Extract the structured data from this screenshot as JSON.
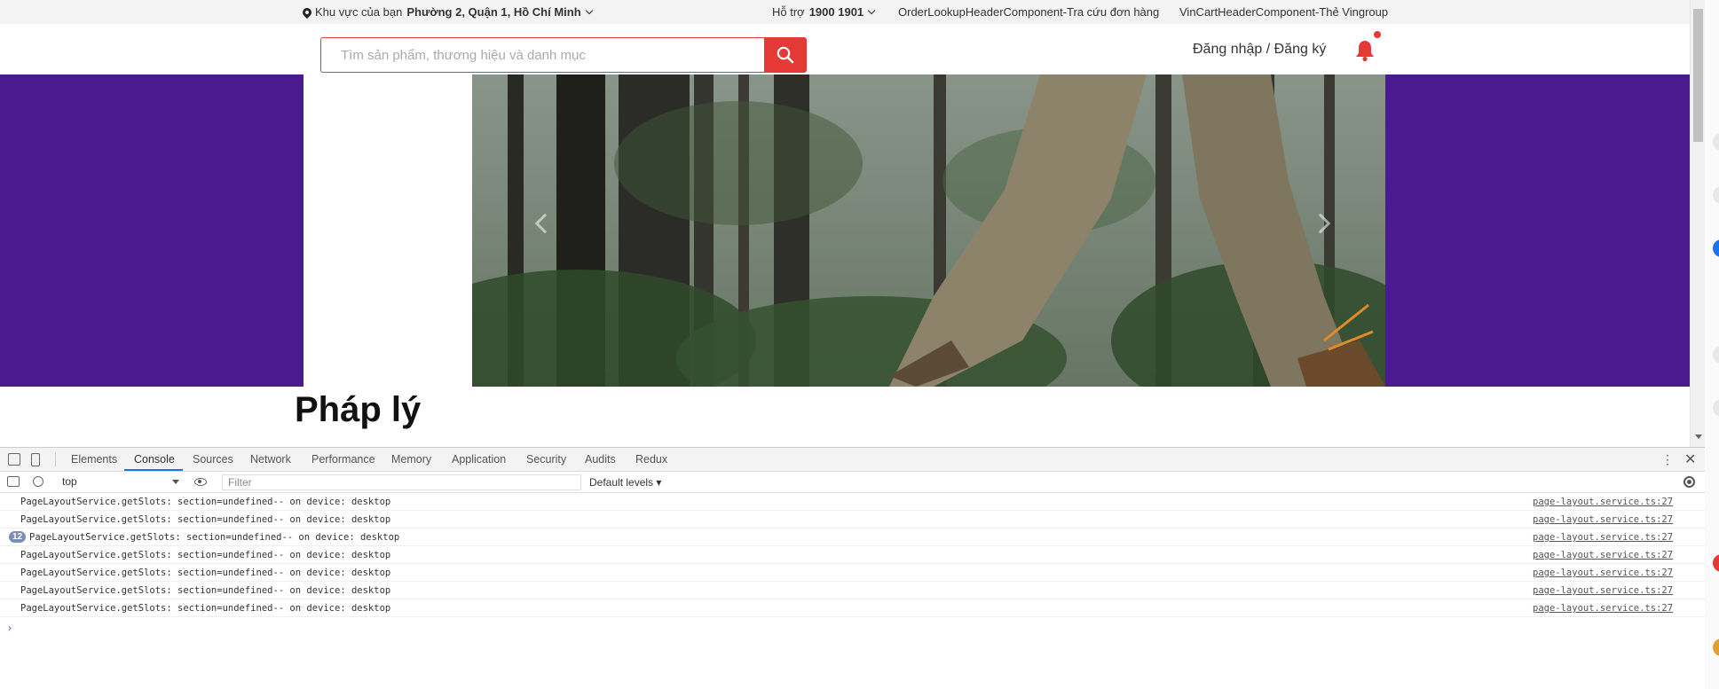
{
  "topbar": {
    "region_label": "Khu vực của bạn",
    "region_value": "Phường 2, Quận 1, Hồ Chí Minh",
    "support_label": "Hỗ trợ",
    "support_number": "1900 1901",
    "order_lookup": "OrderLookupHeaderComponent-Tra cứu đơn hàng",
    "vincart": "VinCartHeaderComponent-Thẻ Vingroup"
  },
  "header": {
    "search_placeholder": "Tìm sản phẩm, thương hiệu và danh mục",
    "login_register": "Đăng nhập / Đăng ký"
  },
  "page": {
    "title": "Pháp lý"
  },
  "colors": {
    "brand_red": "#e53935",
    "banner_purple": "#4a1a91"
  },
  "devtools": {
    "tabs": [
      "Elements",
      "Console",
      "Sources",
      "Network",
      "Performance",
      "Memory",
      "Application",
      "Security",
      "Audits",
      "Redux"
    ],
    "active_tab": "Console",
    "context": "top",
    "filter_placeholder": "Filter",
    "levels": "Default levels",
    "logs": [
      {
        "message": "PageLayoutService.getSlots: section=undefined-- on device: desktop",
        "source": "page-layout.service.ts:27",
        "count": null
      },
      {
        "message": "PageLayoutService.getSlots: section=undefined-- on device: desktop",
        "source": "page-layout.service.ts:27",
        "count": null
      },
      {
        "message": "PageLayoutService.getSlots: section=undefined-- on device: desktop",
        "source": "page-layout.service.ts:27",
        "count": "12"
      },
      {
        "message": "PageLayoutService.getSlots: section=undefined-- on device: desktop",
        "source": "page-layout.service.ts:27",
        "count": null
      },
      {
        "message": "PageLayoutService.getSlots: section=undefined-- on device: desktop",
        "source": "page-layout.service.ts:27",
        "count": null
      },
      {
        "message": "PageLayoutService.getSlots: section=undefined-- on device: desktop",
        "source": "page-layout.service.ts:27",
        "count": null
      },
      {
        "message": "PageLayoutService.getSlots: section=undefined-- on device: desktop",
        "source": "page-layout.service.ts:27",
        "count": null
      }
    ]
  }
}
